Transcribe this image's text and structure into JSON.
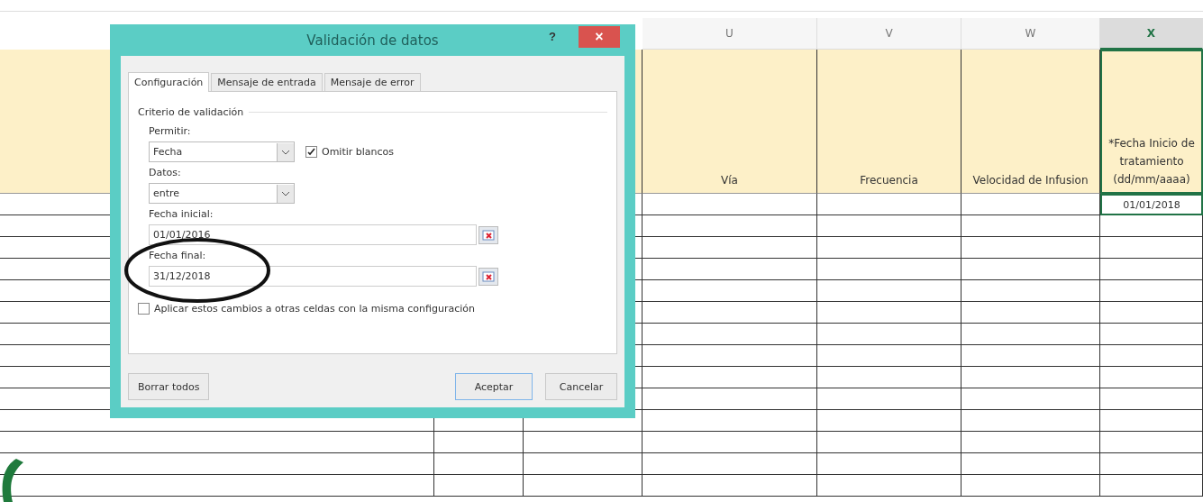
{
  "sheet": {
    "columns": [
      {
        "letter": "U",
        "header": "Vía",
        "selected": false
      },
      {
        "letter": "V",
        "header": "Frecuencia",
        "selected": false
      },
      {
        "letter": "W",
        "header": "Velocidad de Infusion",
        "selected": false
      },
      {
        "letter": "X",
        "header": "*Fecha Inicio de tratamiento (dd/mm/aaaa)",
        "selected": true,
        "value": "01/01/2018"
      }
    ]
  },
  "dialog": {
    "title": "Validación de datos",
    "help": "?",
    "close": "×",
    "tabs": [
      {
        "label": "Configuración",
        "selected": true
      },
      {
        "label": "Mensaje de entrada",
        "selected": false
      },
      {
        "label": "Mensaje de error",
        "selected": false
      }
    ],
    "section": "Criterio de validación",
    "allow": {
      "label": "Permitir:",
      "value": "Fecha"
    },
    "ignore_blank": {
      "label": "Omitir blancos",
      "checked": true
    },
    "data": {
      "label": "Datos:",
      "value": "entre"
    },
    "start": {
      "label": "Fecha inicial:",
      "value": "01/01/2016"
    },
    "end": {
      "label": "Fecha final:",
      "value": "31/12/2018"
    },
    "apply_all": {
      "label": "Aplicar estos cambios a otras celdas con la misma configuración",
      "checked": false
    },
    "buttons": [
      {
        "label": "Borrar todos",
        "kind": "left"
      },
      {
        "label": "Aceptar",
        "kind": "default"
      },
      {
        "label": "Cancelar",
        "kind": "normal"
      }
    ]
  }
}
